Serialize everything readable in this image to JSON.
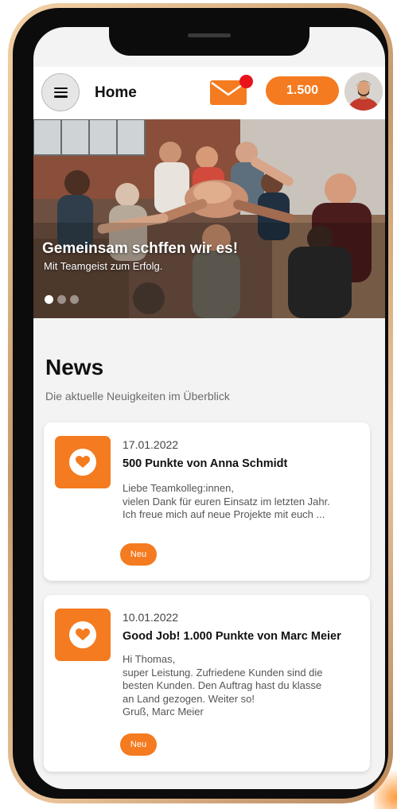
{
  "colors": {
    "accent": "#f47b1f",
    "notification_dot": "#e8131b",
    "background": "#f3f3f3",
    "card": "#ffffff",
    "frame_gold": "#d9a878"
  },
  "header": {
    "menu_icon": "hamburger-menu-icon",
    "title": "Home",
    "mail_icon": "envelope-icon",
    "has_unread": true,
    "points": "1.500",
    "avatar_icon": "user-avatar"
  },
  "hero": {
    "title": "Gemeinsam schffen wir es!",
    "subtitle": "Mit Teamgeist zum Erfolg.",
    "slide_count": 3,
    "active_slide": 1
  },
  "news": {
    "heading": "News",
    "subtitle": "Die aktuelle Neuigkeiten im Überblick",
    "items": [
      {
        "icon": "heart-icon",
        "date": "17.01.2022",
        "title": "500 Punkte von Anna Schmidt",
        "body_lines": [
          "Liebe Teamkolleg:innen,",
          "vielen Dank für euren Einsatz im letzten Jahr.",
          "Ich freue mich auf neue Projekte mit euch ..."
        ],
        "badge": "Neu"
      },
      {
        "icon": "heart-icon",
        "date": "10.01.2022",
        "title": "Good Job! 1.000 Punkte von Marc Meier",
        "body_lines": [
          "Hi Thomas,",
          "super Leistung. Zufriedene Kunden sind die",
          "besten Kunden. Den Auftrag hast du klasse",
          "an Land gezogen. Weiter so!",
          "Gruß, Marc Meier"
        ],
        "badge": "Neu"
      }
    ]
  }
}
